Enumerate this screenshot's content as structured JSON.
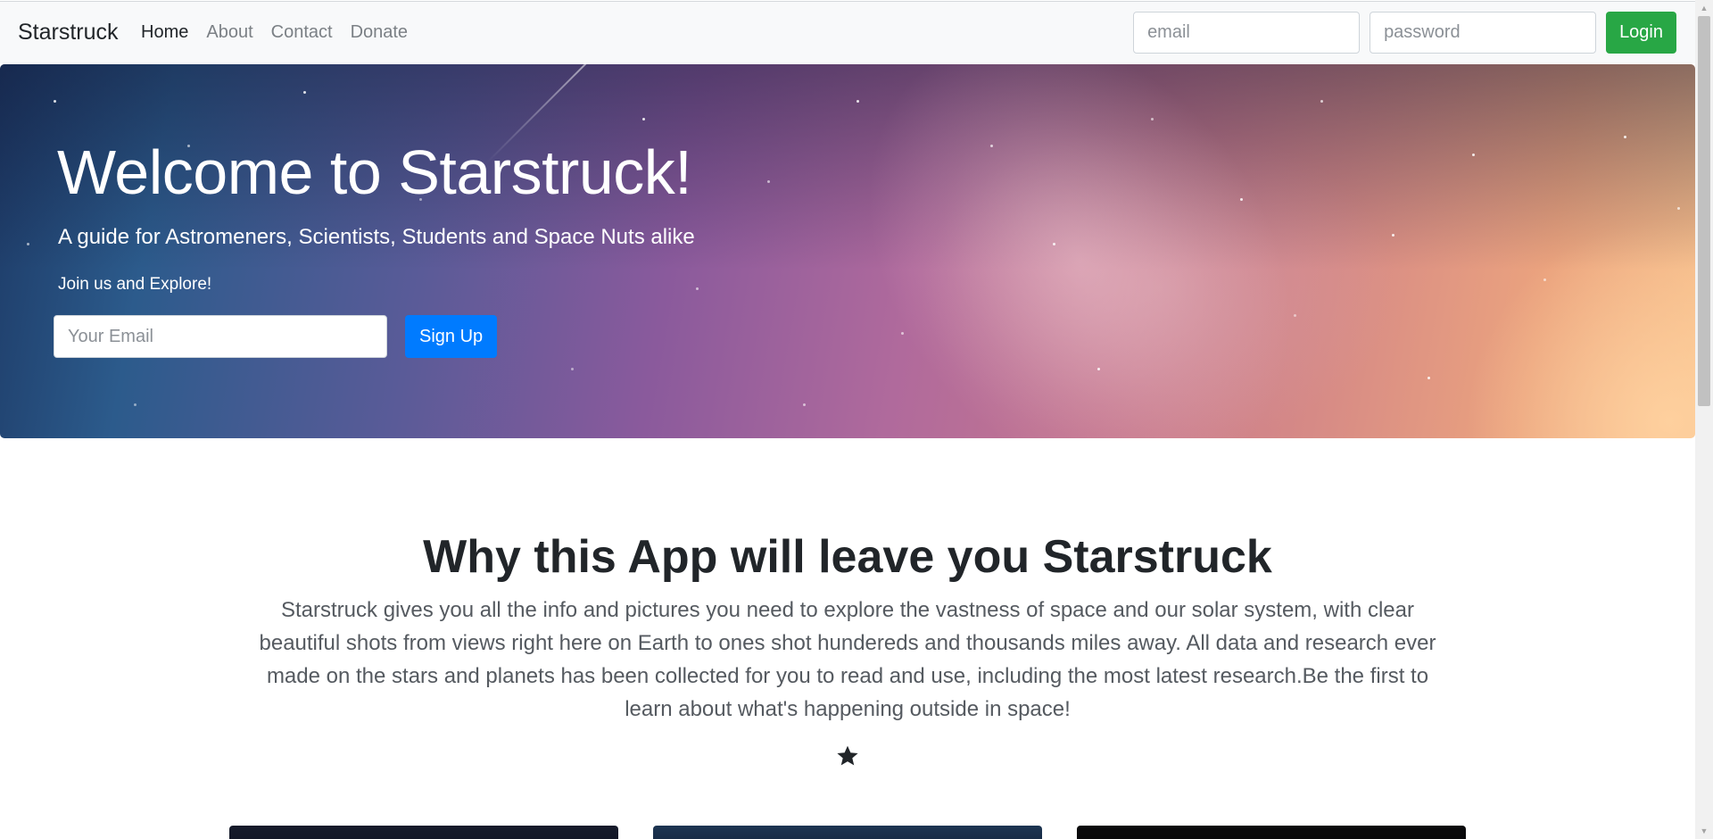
{
  "navbar": {
    "brand": "Starstruck",
    "links": [
      {
        "label": "Home",
        "active": true
      },
      {
        "label": "About",
        "active": false
      },
      {
        "label": "Contact",
        "active": false
      },
      {
        "label": "Donate",
        "active": false
      }
    ],
    "email_placeholder": "email",
    "password_placeholder": "password",
    "login_label": "Login"
  },
  "hero": {
    "title": "Welcome to Starstruck!",
    "subtitle": "A guide for Astromeners, Scientists, Students and Space Nuts alike",
    "join_text": "Join us and Explore!",
    "email_placeholder": "Your Email",
    "signup_label": "Sign Up"
  },
  "about": {
    "title": "Why this App will leave you Starstruck",
    "body": "Starstruck gives you all the info and pictures you need to explore the vastness of space and our solar system, with clear beautiful shots from views right here on Earth to ones shot hundereds and thousands miles away. All data and research ever made on the stars and planets has been collected for you to read and use, including the most latest research.Be the first to learn about what's happening outside in space!",
    "divider_icon": "star-icon"
  },
  "colors": {
    "navbar_bg": "#f8f9fa",
    "login_button": "#28a745",
    "signup_button": "#007bff",
    "text_dark": "#212529"
  }
}
